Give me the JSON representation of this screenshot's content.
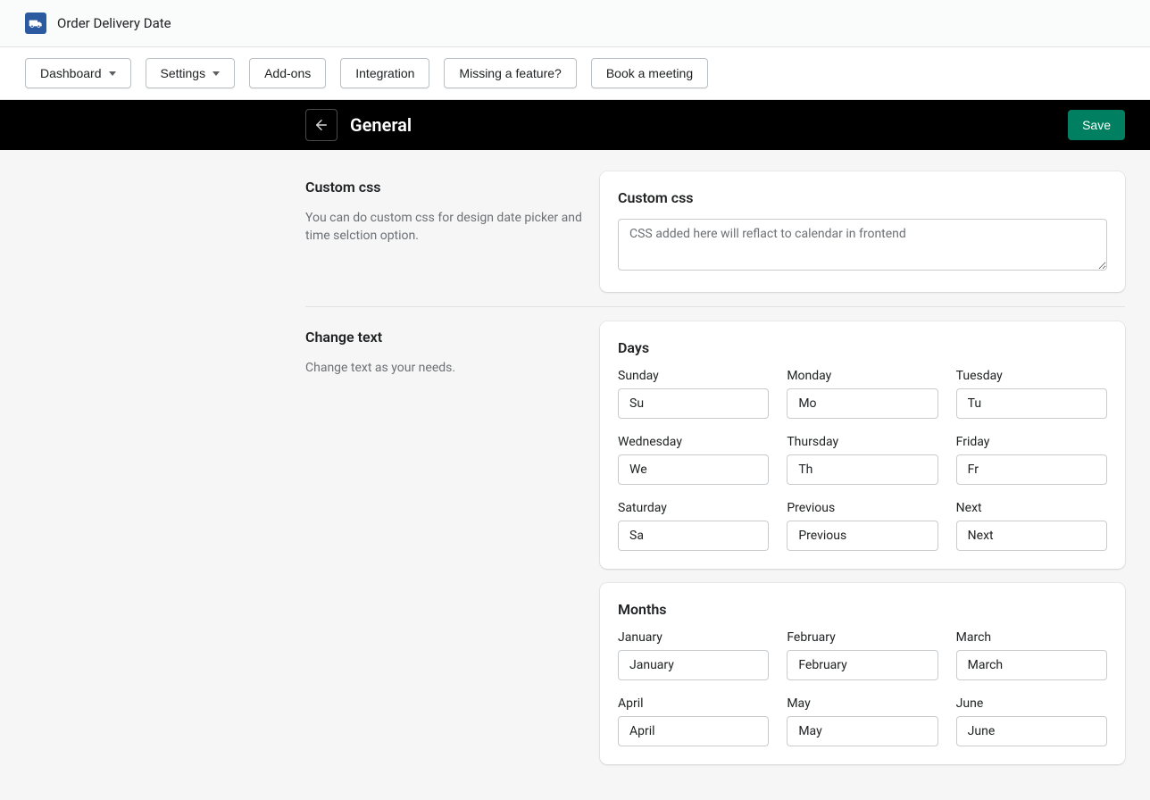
{
  "app": {
    "title": "Order Delivery Date"
  },
  "nav": {
    "dashboard": "Dashboard",
    "settings": "Settings",
    "addons": "Add-ons",
    "integration": "Integration",
    "missing": "Missing a feature?",
    "book": "Book a meeting"
  },
  "subheader": {
    "title": "General",
    "save": "Save"
  },
  "sections": {
    "custom_css": {
      "heading": "Custom css",
      "desc": "You can do custom css for design date picker and time selction option.",
      "card_title": "Custom css",
      "placeholder": "CSS added here will reflact to calendar in frontend"
    },
    "change_text": {
      "heading": "Change text",
      "desc": "Change text as your needs."
    }
  },
  "days": {
    "title": "Days",
    "fields": [
      {
        "label": "Sunday",
        "value": "Su"
      },
      {
        "label": "Monday",
        "value": "Mo"
      },
      {
        "label": "Tuesday",
        "value": "Tu"
      },
      {
        "label": "Wednesday",
        "value": "We"
      },
      {
        "label": "Thursday",
        "value": "Th"
      },
      {
        "label": "Friday",
        "value": "Fr"
      },
      {
        "label": "Saturday",
        "value": "Sa"
      },
      {
        "label": "Previous",
        "value": "Previous"
      },
      {
        "label": "Next",
        "value": "Next"
      }
    ]
  },
  "months": {
    "title": "Months",
    "fields": [
      {
        "label": "January",
        "value": "January"
      },
      {
        "label": "February",
        "value": "February"
      },
      {
        "label": "March",
        "value": "March"
      },
      {
        "label": "April",
        "value": "April"
      },
      {
        "label": "May",
        "value": "May"
      },
      {
        "label": "June",
        "value": "June"
      }
    ]
  }
}
